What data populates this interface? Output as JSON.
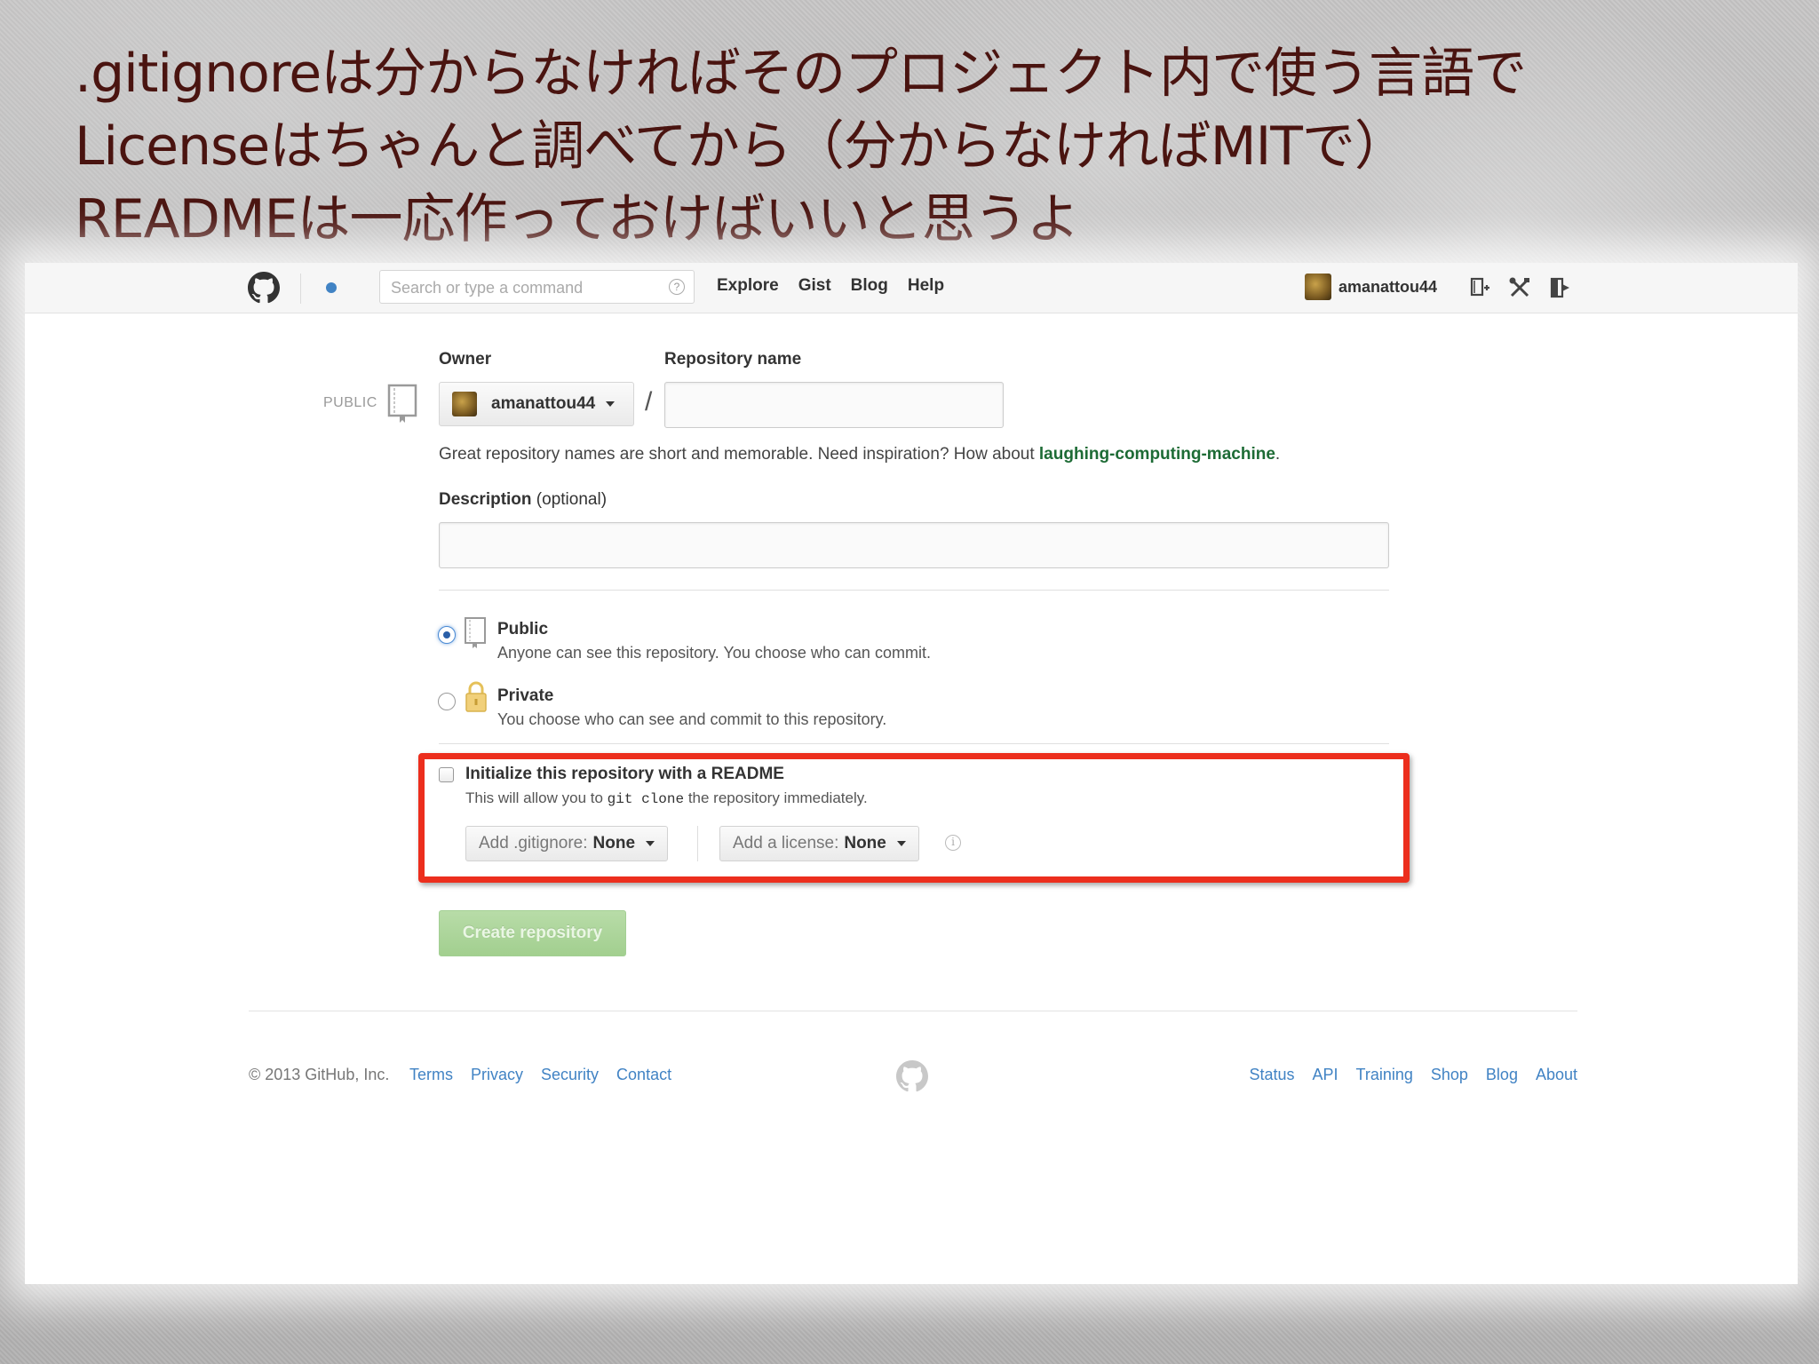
{
  "slide": {
    "title_lines": [
      ".gitignoreは分からなければそのプロジェクト内で使う言語で",
      "Licenseはちゃんと調べてから（分からなければMITで）",
      "READMEは一応作っておけばいいと思うよ"
    ],
    "title_color": "#4a1410"
  },
  "nav": {
    "search_placeholder": "Search or type a command",
    "help_glyph": "?",
    "links": [
      "Explore",
      "Gist",
      "Blog",
      "Help"
    ],
    "username": "amanattou44",
    "icons": [
      "new-repo-icon",
      "settings-tools-icon",
      "sign-out-icon"
    ]
  },
  "form": {
    "owner_label": "Owner",
    "repo_name_label": "Repository name",
    "public_tag": "PUBLIC",
    "owner_value": "amanattou44",
    "slash": "/",
    "repo_name_value": "",
    "hint_prefix": "Great repository names are short and memorable. Need inspiration? How about ",
    "hint_suggestion": "laughing-computing-machine",
    "hint_suffix": ".",
    "description_label": "Description",
    "description_optional": " (optional)",
    "description_value": "",
    "visibility": {
      "selected": "public",
      "public_title": "Public",
      "public_desc": "Anyone can see this repository. You choose who can commit.",
      "private_title": "Private",
      "private_desc": "You choose who can see and commit to this repository."
    },
    "init": {
      "checked": false,
      "title": "Initialize this repository with a README",
      "desc_prefix": "This will allow you to ",
      "desc_code": "git clone",
      "desc_suffix": " the repository immediately.",
      "gitignore_label": "Add .gitignore:",
      "gitignore_value": "None",
      "license_label": "Add a license:",
      "license_value": "None",
      "info_glyph": "i"
    },
    "create_button": "Create repository"
  },
  "footer": {
    "copyright": "© 2013 GitHub, Inc.",
    "left_links": [
      "Terms",
      "Privacy",
      "Security",
      "Contact"
    ],
    "right_links": [
      "Status",
      "API",
      "Training",
      "Shop",
      "Blog",
      "About"
    ]
  },
  "colors": {
    "highlight_border": "#ec2e1d",
    "link": "#4183c4",
    "suggestion": "#1d6b35",
    "create_button": "#a9d399"
  }
}
